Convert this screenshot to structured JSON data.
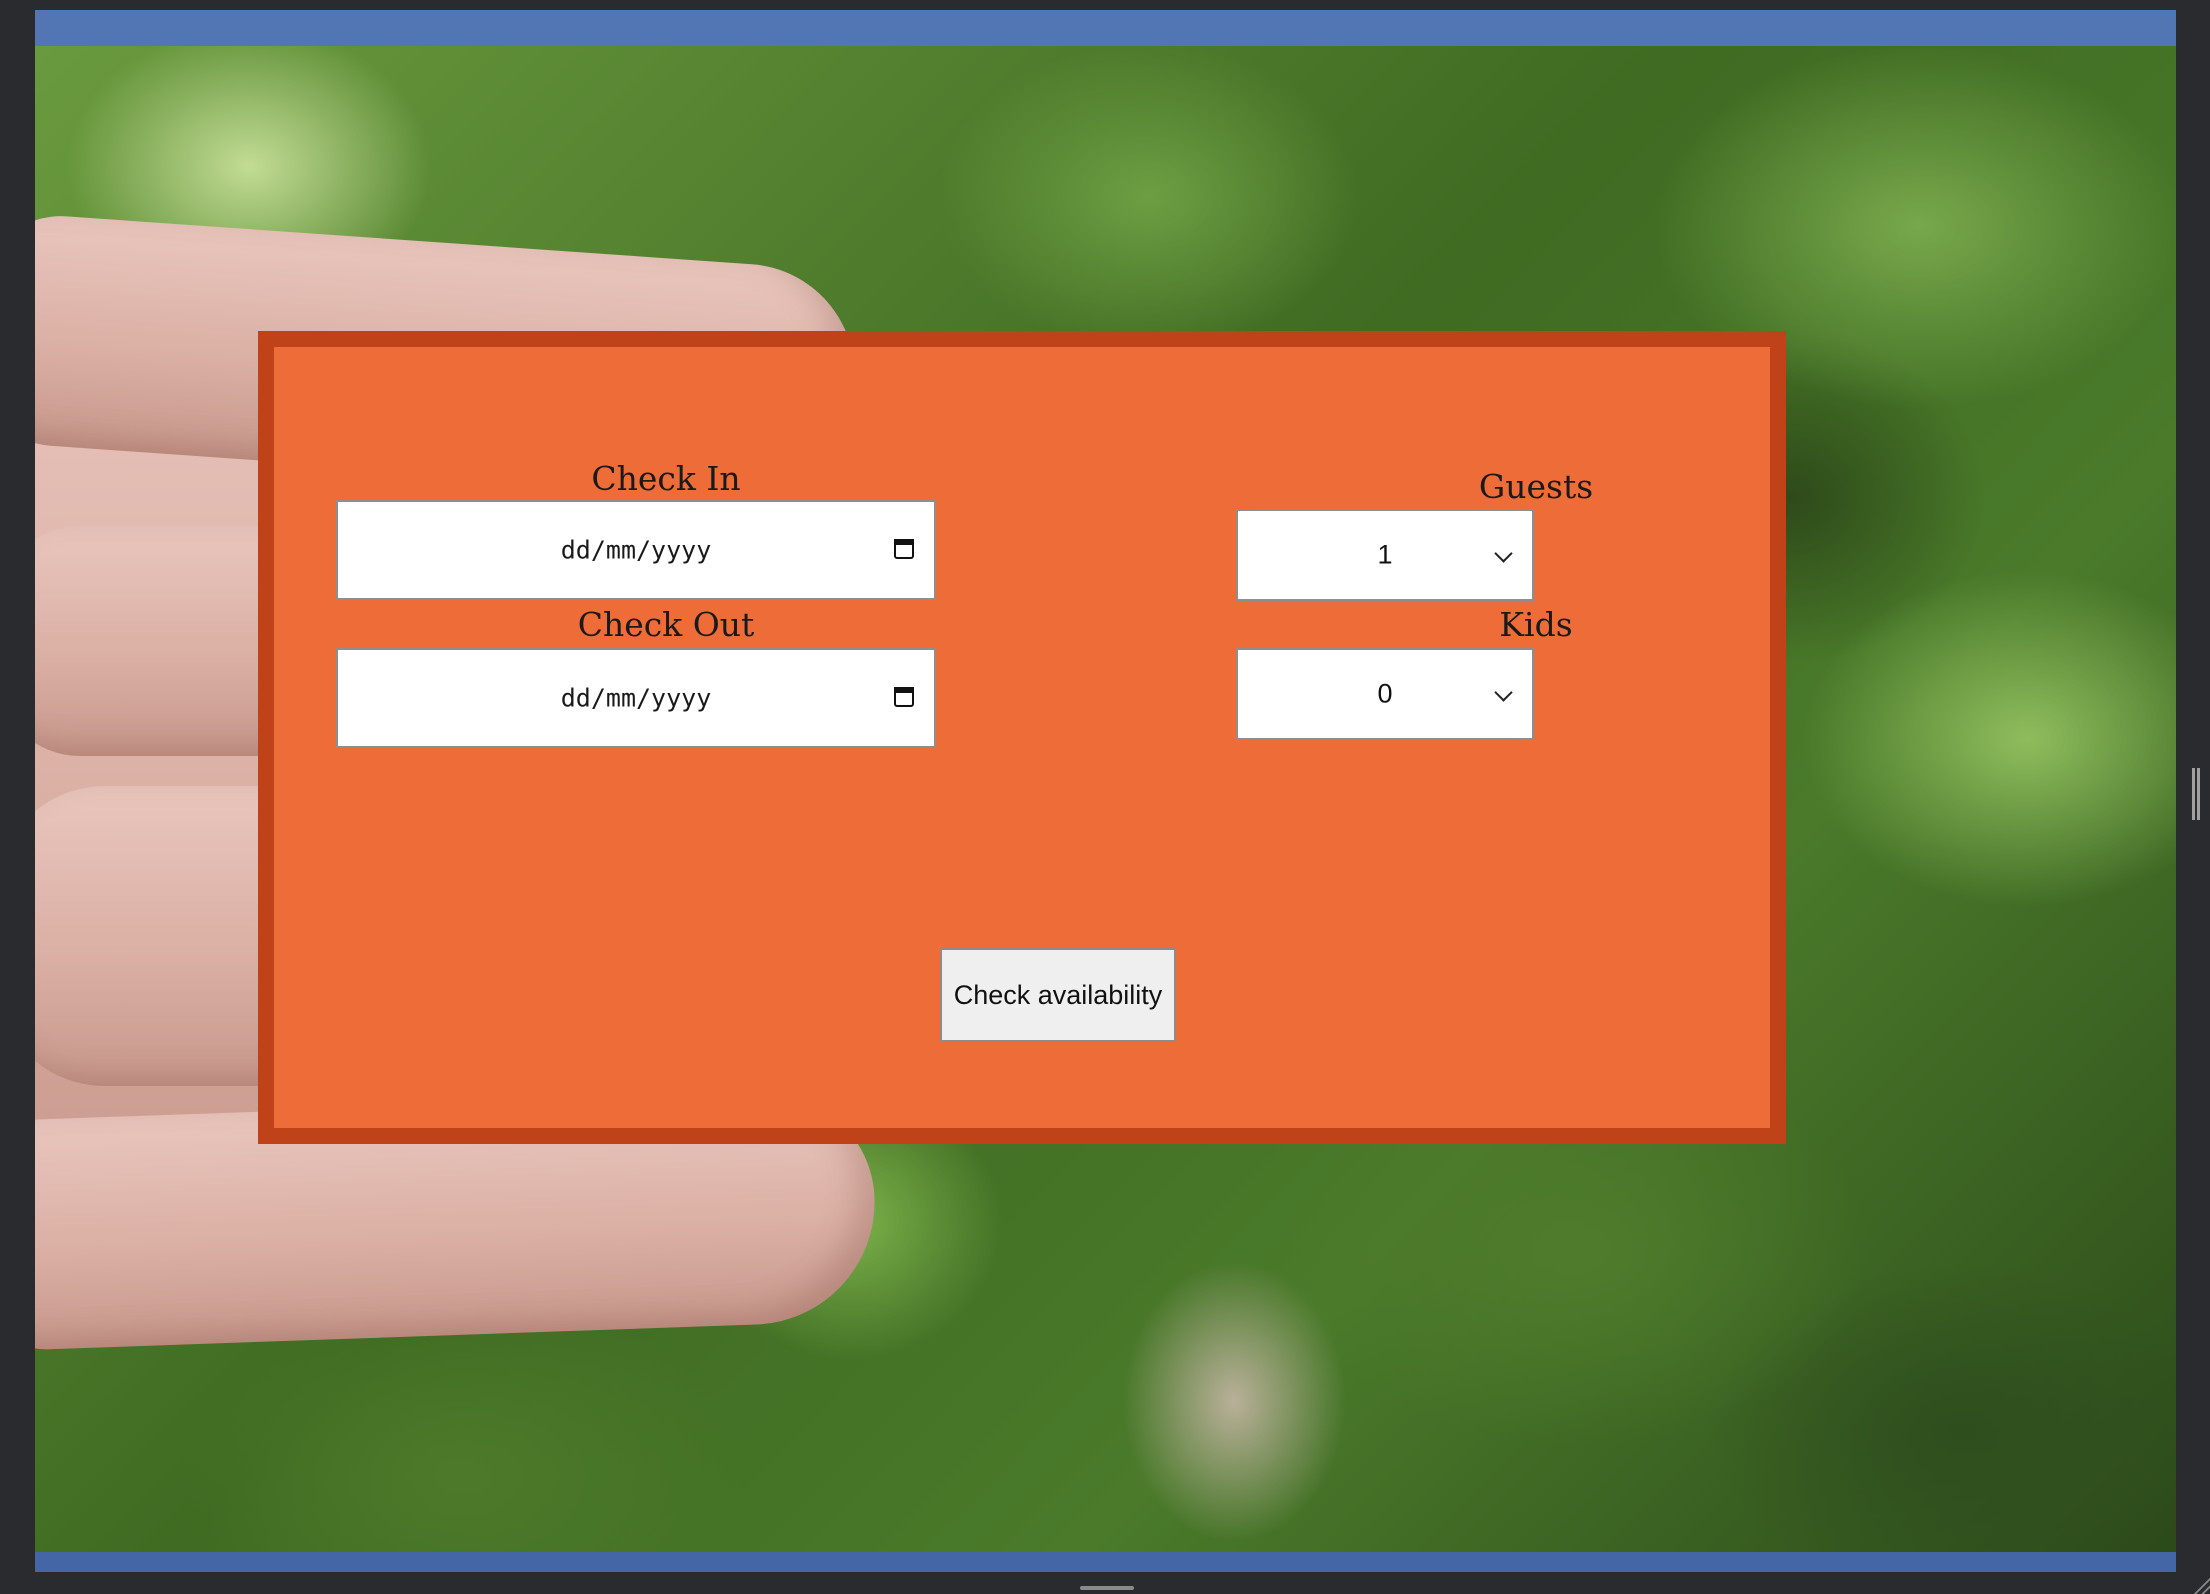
{
  "form": {
    "check_in": {
      "label": "Check In",
      "placeholder": "dd/mm/yyyy"
    },
    "check_out": {
      "label": "Check Out",
      "placeholder": "dd/mm/yyyy"
    },
    "guests": {
      "label": "Guests",
      "value": "1"
    },
    "kids": {
      "label": "Kids",
      "value": "0"
    },
    "submit_label": "Check availability"
  },
  "colors": {
    "card_background": "#ed6c38",
    "card_border": "#bf4218",
    "top_bar": "#5276b4",
    "bottom_bar": "#4465a6"
  },
  "icons": [
    "calendar-icon",
    "chevron-down-icon"
  ]
}
